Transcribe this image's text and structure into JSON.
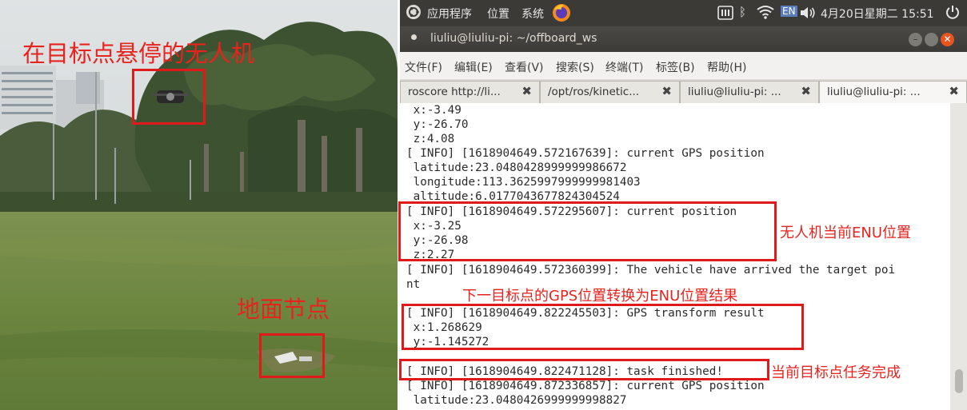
{
  "photo_annotations": {
    "drone_label": "在目标点悬停的无人机",
    "ground_node_label": "地面节点"
  },
  "top_panel": {
    "menus": [
      "应用程序",
      "位置",
      "系统"
    ],
    "keyboard_indicator": "EN",
    "datetime": "4月20日星期二 15:51"
  },
  "window": {
    "title": "liuliu@liuliu-pi: ~/offboard_ws",
    "menu": [
      "文件(F)",
      "编辑(E)",
      "查看(V)",
      "搜索(S)",
      "终端(T)",
      "标签(B)",
      "帮助(H)"
    ],
    "tabs": [
      {
        "label": "roscore http://li...",
        "active": false
      },
      {
        "label": "/opt/ros/kinetic...",
        "active": false
      },
      {
        "label": "liuliu@liuliu-pi: ...",
        "active": false
      },
      {
        "label": "liuliu@liuliu-pi: ...",
        "active": true
      }
    ]
  },
  "terminal_lines": [
    " x:-3.49",
    " y:-26.70",
    " z:4.08",
    "[ INFO] [1618904649.572167639]: current GPS position",
    " latitude:23.0480428999999986672",
    " longitude:113.3625997999999981403",
    " altitude:6.0177043677824304524",
    "[ INFO] [1618904649.572295607]: current position",
    " x:-3.25",
    " y:-26.98",
    " z:2.27",
    "[ INFO] [1618904649.572360399]: The vehicle have arrived the target poi",
    "nt",
    "",
    "[ INFO] [1618904649.822245503]: GPS transform result",
    " x:1.268629",
    " y:-1.145272",
    "",
    "[ INFO] [1618904649.822471128]: task finished!",
    "[ INFO] [1618904649.872336857]: current GPS position",
    " latitude:23.0480426999999998827"
  ],
  "terminal_annotations": {
    "enu_position": "无人机当前ENU位置",
    "gps_to_enu": "下一目标点的GPS位置转换为ENU位置结果",
    "task_complete": "当前目标点任务完成"
  },
  "colors": {
    "annotation_red": "#e8231e",
    "ubuntu_panel": "#3b3a36",
    "close_button": "#e9541f"
  }
}
